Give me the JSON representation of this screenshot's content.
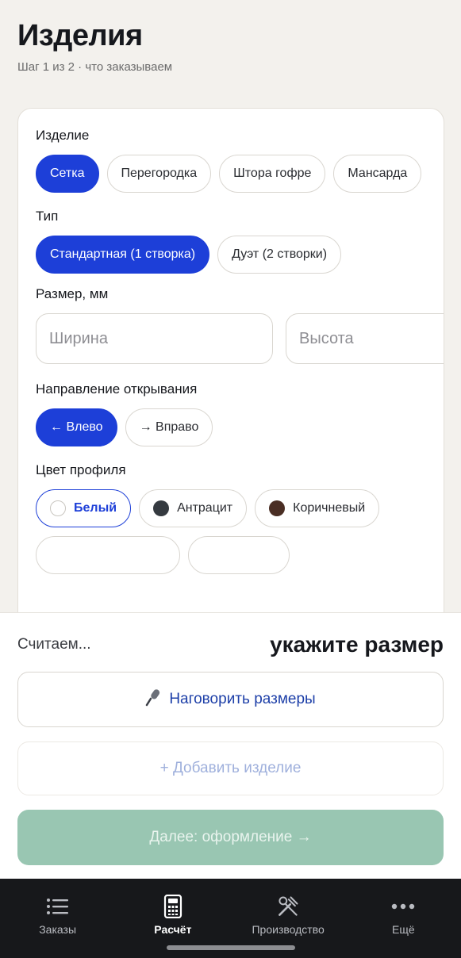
{
  "header": {
    "title": "Изделия",
    "subtitle": "Шаг 1 из 2 · что заказываем"
  },
  "form": {
    "product": {
      "label": "Изделие",
      "options": [
        "Сетка",
        "Перегородка",
        "Штора гофре",
        "Мансарда"
      ],
      "selected": "Сетка"
    },
    "type": {
      "label": "Тип",
      "options": [
        "Стандартная (1 створка)",
        "Дуэт (2 створки)"
      ],
      "selected": "Стандартная (1 створка)"
    },
    "size": {
      "label": "Размер, мм",
      "width_placeholder": "Ширина",
      "height_placeholder": "Высота"
    },
    "direction": {
      "label": "Направление открывания",
      "options": [
        "← Влево",
        "→ Вправо"
      ],
      "selected": "← Влево"
    },
    "color": {
      "label": "Цвет профиля",
      "options": [
        {
          "label": "Белый",
          "swatch": "#ffffff"
        },
        {
          "label": "Антрацит",
          "swatch": "#353a40"
        },
        {
          "label": "Коричневый",
          "swatch": "#4a2e24"
        }
      ],
      "selected": "Белый"
    }
  },
  "summary": {
    "status": "Считаем...",
    "hint": "укажите размер"
  },
  "actions": {
    "voice_icon": "microphone-icon",
    "voice_label": "Наговорить размеры",
    "add_label": "+ Добавить изделие",
    "next_label": "Далее: оформление →"
  },
  "tabbar": {
    "items": [
      {
        "label": "Заказы",
        "icon": "list-icon"
      },
      {
        "label": "Расчёт",
        "icon": "calculator-icon"
      },
      {
        "label": "Производство",
        "icon": "tools-icon"
      },
      {
        "label": "Ещё",
        "icon": "more-icon"
      }
    ],
    "active": "Расчёт"
  },
  "colors": {
    "accent": "#1d3fd8",
    "next_button": "#99c6b2",
    "tabbar_bg": "#17181b"
  }
}
